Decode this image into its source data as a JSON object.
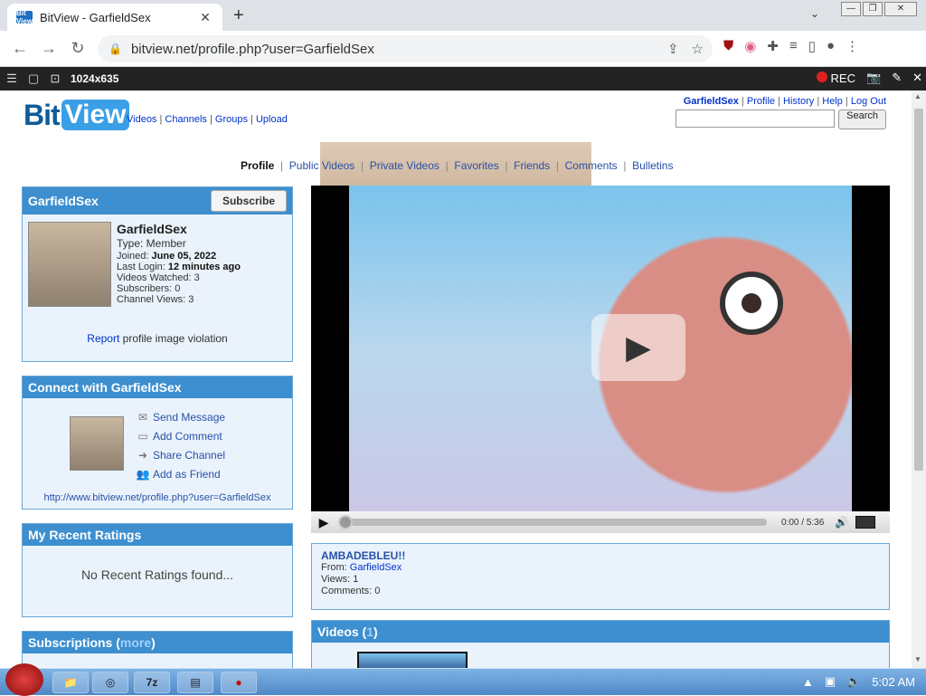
{
  "browser": {
    "tab_title": "BitView - GarfieldSex",
    "favicon": "Bit View",
    "url": "bitview.net/profile.php?user=GarfieldSex"
  },
  "recorder": {
    "resolution": "1024x635",
    "rec_label": "REC"
  },
  "site": {
    "logo_bit": "Bit",
    "logo_view": "View",
    "nav": [
      "Videos",
      "Channels",
      "Groups",
      "Upload"
    ],
    "user_links": [
      "GarfieldSex",
      "Profile",
      "History",
      "Help",
      "Log Out"
    ],
    "search_label": "Search"
  },
  "profile_tabs": [
    "Profile",
    "Public Videos",
    "Private Videos",
    "Favorites",
    "Friends",
    "Comments",
    "Bulletins"
  ],
  "profile_box": {
    "header": "GarfieldSex",
    "subscribe": "Subscribe",
    "name": "GarfieldSex",
    "type": "Type: Member",
    "joined_label": "Joined:",
    "joined": "June 05, 2022",
    "last_login_label": "Last Login:",
    "last_login": "12 minutes ago",
    "videos_watched": "Videos Watched: 3",
    "subscribers": "Subscribers: 0",
    "channel_views": "Channel Views: 3",
    "report_link": "Report",
    "report_text": "profile image violation"
  },
  "connect_box": {
    "header": "Connect with GarfieldSex",
    "items": [
      "Send Message",
      "Add Comment",
      "Share Channel",
      "Add as Friend"
    ],
    "url": "http://www.bitview.net/profile.php?user=GarfieldSex"
  },
  "ratings_box": {
    "header": "My Recent Ratings",
    "empty": "No Recent Ratings found..."
  },
  "subscriptions_box": {
    "header": "Subscriptions (",
    "more": "more",
    "close": ")"
  },
  "player": {
    "time": "0:00 / 5:36"
  },
  "video_info": {
    "title": "AMBADEBLEU!!",
    "from_label": "From:",
    "from": "GarfieldSex",
    "views": "Views: 1",
    "comments": "Comments: 0"
  },
  "videos_box": {
    "header": "Videos (",
    "count": "1",
    "close": ")"
  },
  "taskbar": {
    "time": "5:02 AM"
  }
}
